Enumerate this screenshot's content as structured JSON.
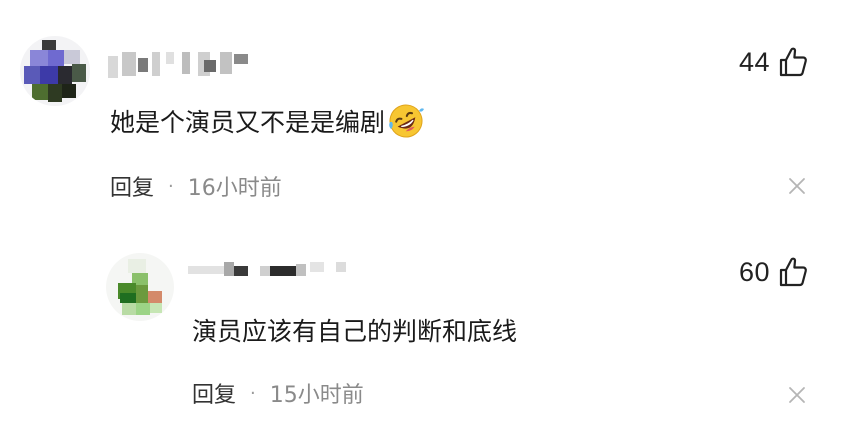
{
  "comments": [
    {
      "text": "她是个演员又不是是编剧",
      "emoji": "rolling-on-floor-laughing-emoji",
      "likes": "44",
      "reply_label": "回复",
      "separator": "·",
      "time": "16小时前",
      "close_icon": "close-icon",
      "like_icon": "thumbs-up-icon"
    },
    {
      "text": "演员应该有自己的判断和底线",
      "likes": "60",
      "reply_label": "回复",
      "separator": "·",
      "time": "15小时前",
      "close_icon": "close-icon",
      "like_icon": "thumbs-up-icon"
    }
  ],
  "colors": {
    "text": "#1a1a1a",
    "meta_time": "#8a8a8a",
    "close_icon": "#b5b5b5",
    "background": "#ffffff"
  }
}
